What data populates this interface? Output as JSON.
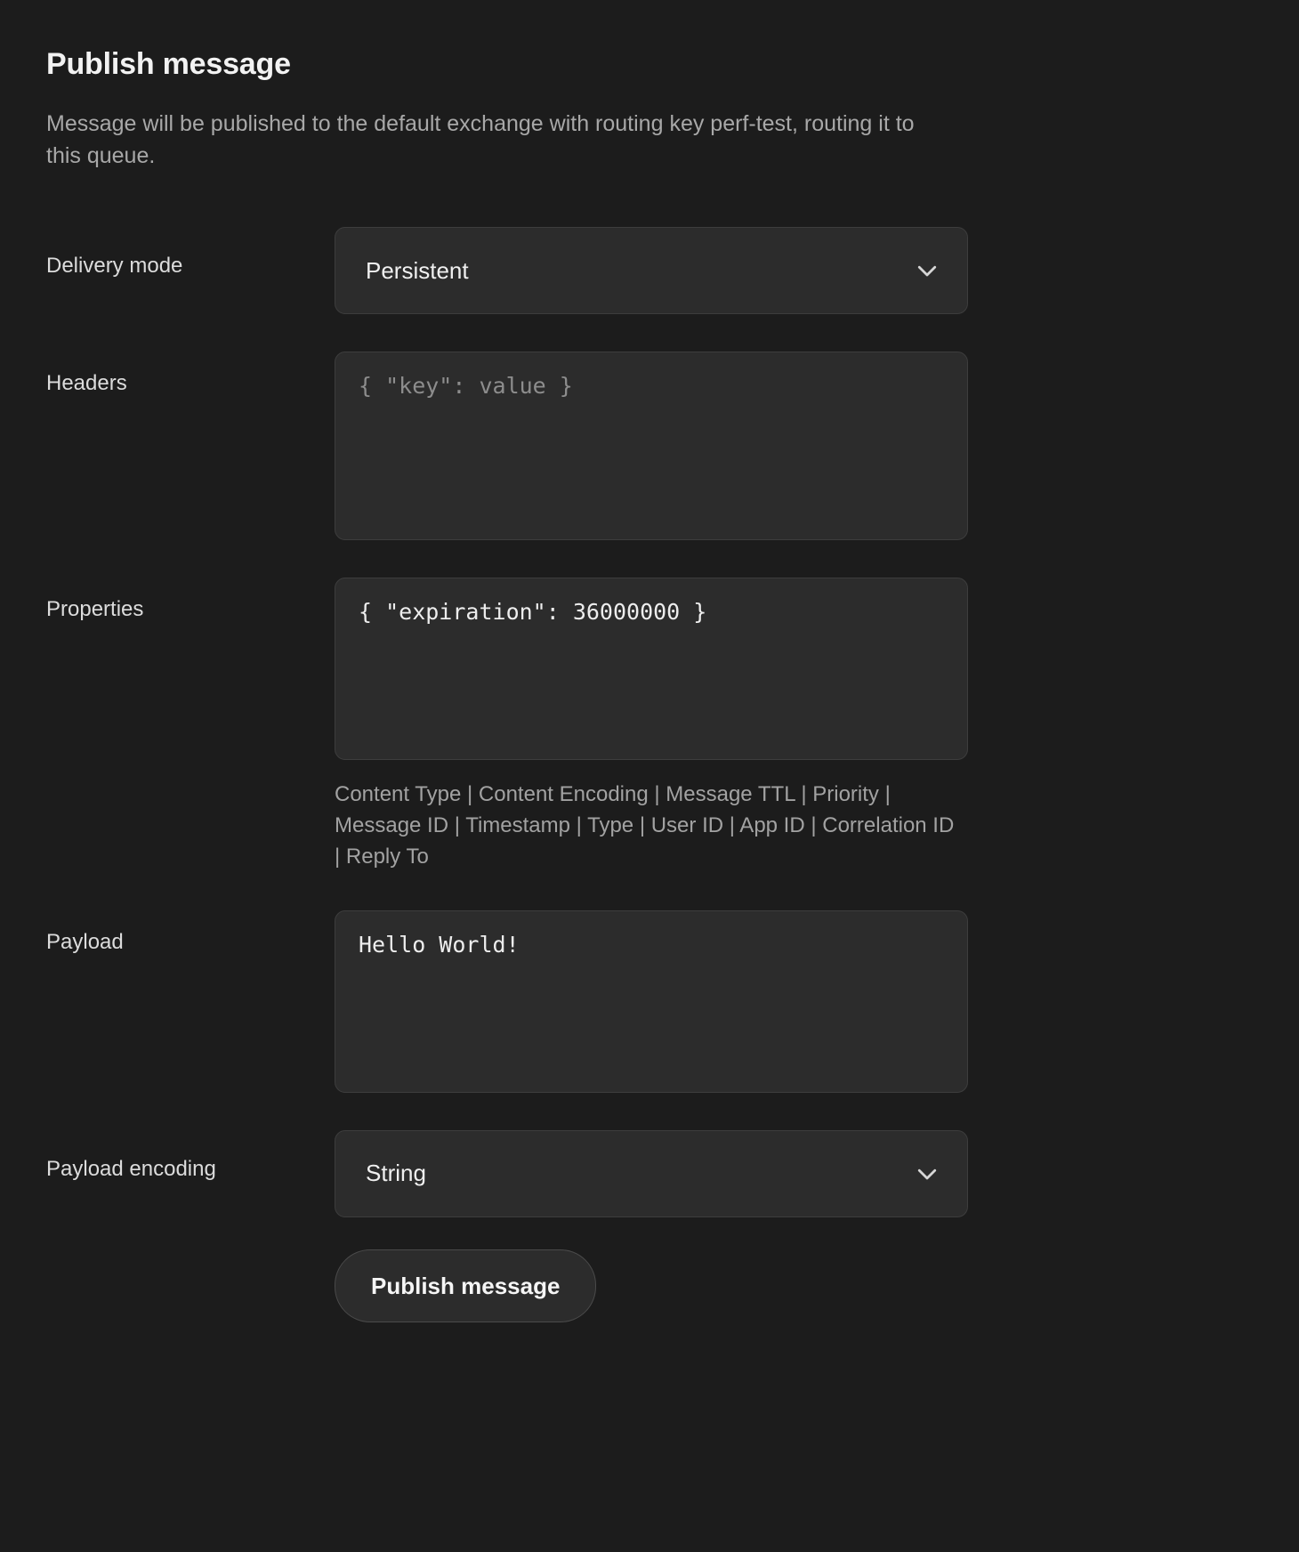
{
  "panel": {
    "title": "Publish message",
    "description": "Message will be published to the default exchange with routing key perf-test, routing it to this queue."
  },
  "form": {
    "delivery_mode": {
      "label": "Delivery mode",
      "value": "Persistent",
      "icon": "chevron-down-icon"
    },
    "headers": {
      "label": "Headers",
      "value": "",
      "placeholder": "{ \"key\": value }"
    },
    "properties": {
      "label": "Properties",
      "value": "{ \"expiration\": 36000000 }",
      "placeholder": "",
      "hint_items": [
        "Content Type",
        "Content Encoding",
        "Message TTL",
        "Priority",
        "Message ID",
        "Timestamp",
        "Type",
        "User ID",
        "App ID",
        "Correlation ID",
        "Reply To"
      ],
      "hint_text": "Content Type | Content Encoding | Message TTL | Priority | Message ID | Timestamp | Type | User ID | App ID | Correlation ID | Reply To"
    },
    "payload": {
      "label": "Payload",
      "value": "Hello World!",
      "placeholder": ""
    },
    "payload_encoding": {
      "label": "Payload encoding",
      "value": "String",
      "icon": "chevron-down-icon"
    },
    "submit": {
      "label": "Publish message"
    }
  },
  "colors": {
    "background": "#1c1c1c",
    "control_background": "#2c2c2c",
    "control_border": "#3d3d3d",
    "text_primary": "#f2f2f2",
    "text_muted": "#a8a8a8"
  }
}
